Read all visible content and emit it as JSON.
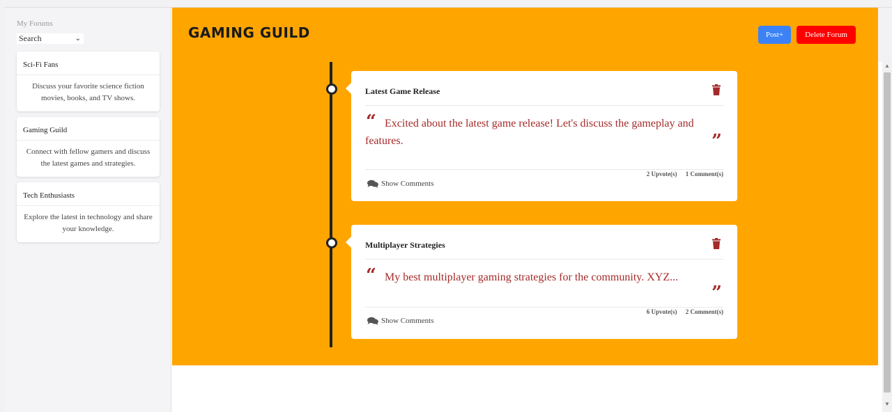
{
  "sidebar": {
    "title": "My Forums",
    "search_value": "Search",
    "forums": [
      {
        "name": "Sci-Fi Fans",
        "description": "Discuss your favorite science fiction movies, books, and TV shows."
      },
      {
        "name": "Gaming Guild",
        "description": "Connect with fellow gamers and discuss the latest games and strategies."
      },
      {
        "name": "Tech Enthusiasts",
        "description": "Explore the latest in technology and share your knowledge."
      }
    ]
  },
  "main": {
    "title": "GAMING GUILD",
    "post_button": "Post+",
    "delete_button": "Delete Forum",
    "background_color": "#ffa500"
  },
  "posts": [
    {
      "title": "Latest Game Release",
      "body": "Excited about the latest game release! Let's discuss the gameplay and features.",
      "upvotes": "2 Upvote(s)",
      "comments": "1 Comment(s)",
      "show_comments": "Show Comments"
    },
    {
      "title": "Multiplayer Strategies",
      "body": "My best multiplayer gaming strategies for the community. XYZ...",
      "upvotes": "6 Upvote(s)",
      "comments": "2 Comment(s)",
      "show_comments": "Show Comments"
    }
  ],
  "icons": {
    "quote_open": "quote-open-icon",
    "quote_close": "quote-close-icon",
    "trash": "trash-icon",
    "comments": "comments-icon",
    "chevron": "chevron-down-icon"
  },
  "colors": {
    "accent_orange": "#ffa500",
    "post_button": "#3b82f6",
    "delete_button": "#ff0000",
    "quote_text": "#a52a2a"
  }
}
